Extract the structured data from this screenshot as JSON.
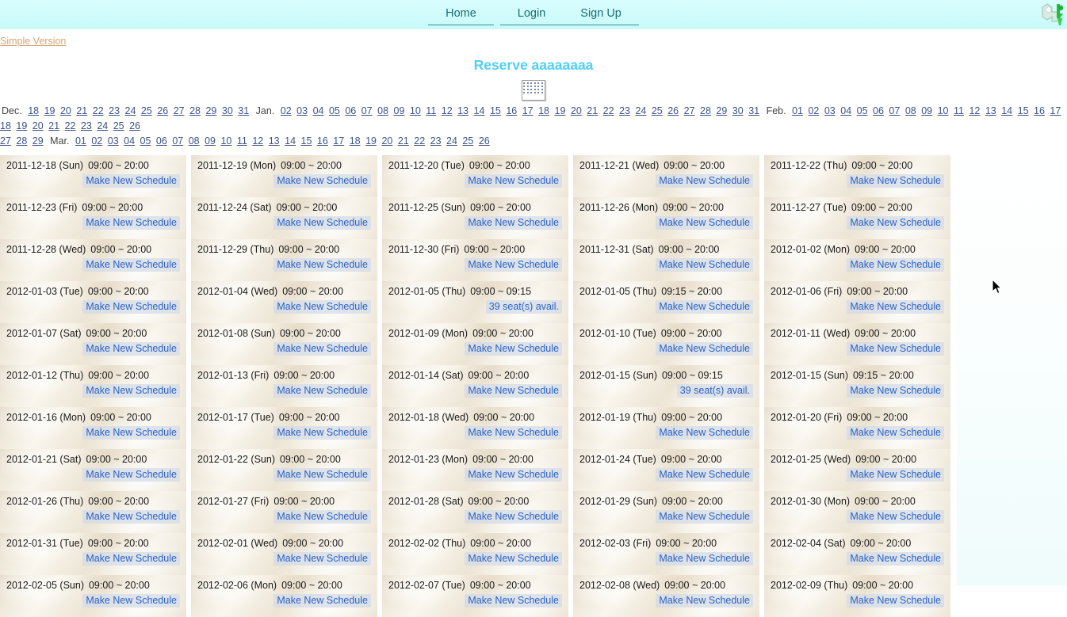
{
  "topbar": {
    "nav": [
      {
        "label": "Home",
        "name": "nav-home"
      },
      {
        "label": "Login",
        "name": "nav-login"
      },
      {
        "label": "Sign Up",
        "name": "nav-signup"
      }
    ],
    "logo_alt": "logo-icon",
    "background_color": "#ccfbfb",
    "link_color": "#1a6e6e"
  },
  "simple_version": {
    "label": "Simple Version",
    "color": "#d8a472"
  },
  "title": {
    "text": "Reserve aaaaaaaa",
    "color": "#4fd0f7"
  },
  "calendar_icon": {
    "name": "calendar-icon"
  },
  "date_nav": {
    "link_color": "#3b5487",
    "lines": [
      [
        {
          "type": "month",
          "text": "Dec."
        },
        {
          "type": "day",
          "text": "18"
        },
        {
          "type": "day",
          "text": "19"
        },
        {
          "type": "day",
          "text": "20"
        },
        {
          "type": "day",
          "text": "21"
        },
        {
          "type": "day",
          "text": "22"
        },
        {
          "type": "day",
          "text": "23"
        },
        {
          "type": "day",
          "text": "24"
        },
        {
          "type": "day",
          "text": "25"
        },
        {
          "type": "day",
          "text": "26"
        },
        {
          "type": "day",
          "text": "27"
        },
        {
          "type": "day",
          "text": "28"
        },
        {
          "type": "day",
          "text": "29"
        },
        {
          "type": "day",
          "text": "30"
        },
        {
          "type": "day",
          "text": "31"
        },
        {
          "type": "month",
          "text": "Jan."
        },
        {
          "type": "day",
          "text": "02"
        },
        {
          "type": "day",
          "text": "03"
        },
        {
          "type": "day",
          "text": "04"
        },
        {
          "type": "day",
          "text": "05"
        },
        {
          "type": "day",
          "text": "06"
        },
        {
          "type": "day",
          "text": "07"
        },
        {
          "type": "day",
          "text": "08"
        },
        {
          "type": "day",
          "text": "09"
        },
        {
          "type": "day",
          "text": "10"
        },
        {
          "type": "day",
          "text": "11"
        },
        {
          "type": "day",
          "text": "12"
        },
        {
          "type": "day",
          "text": "13"
        },
        {
          "type": "day",
          "text": "14"
        },
        {
          "type": "day",
          "text": "15"
        },
        {
          "type": "day",
          "text": "16"
        },
        {
          "type": "day",
          "text": "17"
        },
        {
          "type": "day",
          "text": "18"
        },
        {
          "type": "day",
          "text": "19"
        },
        {
          "type": "day",
          "text": "20"
        },
        {
          "type": "day",
          "text": "21"
        },
        {
          "type": "day",
          "text": "22"
        },
        {
          "type": "day",
          "text": "23"
        },
        {
          "type": "day",
          "text": "24"
        },
        {
          "type": "day",
          "text": "25"
        },
        {
          "type": "day",
          "text": "26"
        },
        {
          "type": "day",
          "text": "27"
        },
        {
          "type": "day",
          "text": "28"
        },
        {
          "type": "day",
          "text": "29"
        },
        {
          "type": "day",
          "text": "30"
        },
        {
          "type": "day",
          "text": "31"
        },
        {
          "type": "month",
          "text": "Feb."
        },
        {
          "type": "day",
          "text": "01"
        },
        {
          "type": "day",
          "text": "02"
        },
        {
          "type": "day",
          "text": "03"
        },
        {
          "type": "day",
          "text": "04"
        },
        {
          "type": "day",
          "text": "05"
        },
        {
          "type": "day",
          "text": "06"
        },
        {
          "type": "day",
          "text": "07"
        },
        {
          "type": "day",
          "text": "08"
        },
        {
          "type": "day",
          "text": "09"
        },
        {
          "type": "day",
          "text": "10"
        },
        {
          "type": "day",
          "text": "11"
        },
        {
          "type": "day",
          "text": "12"
        },
        {
          "type": "day",
          "text": "13"
        },
        {
          "type": "day",
          "text": "14"
        },
        {
          "type": "day",
          "text": "15"
        },
        {
          "type": "day",
          "text": "16"
        },
        {
          "type": "day",
          "text": "17"
        },
        {
          "type": "day",
          "text": "18"
        },
        {
          "type": "day",
          "text": "19"
        },
        {
          "type": "day",
          "text": "20"
        },
        {
          "type": "day",
          "text": "21"
        },
        {
          "type": "day",
          "text": "22"
        },
        {
          "type": "day",
          "text": "23"
        },
        {
          "type": "day",
          "text": "24"
        },
        {
          "type": "day",
          "text": "25"
        },
        {
          "type": "day",
          "text": "26"
        }
      ],
      [
        {
          "type": "day",
          "text": "27"
        },
        {
          "type": "day",
          "text": "28"
        },
        {
          "type": "day",
          "text": "29"
        },
        {
          "type": "month",
          "text": "Mar."
        },
        {
          "type": "day",
          "text": "01"
        },
        {
          "type": "day",
          "text": "02"
        },
        {
          "type": "day",
          "text": "03"
        },
        {
          "type": "day",
          "text": "04"
        },
        {
          "type": "day",
          "text": "05"
        },
        {
          "type": "day",
          "text": "06"
        },
        {
          "type": "day",
          "text": "07"
        },
        {
          "type": "day",
          "text": "08"
        },
        {
          "type": "day",
          "text": "09"
        },
        {
          "type": "day",
          "text": "10"
        },
        {
          "type": "day",
          "text": "11"
        },
        {
          "type": "day",
          "text": "12"
        },
        {
          "type": "day",
          "text": "13"
        },
        {
          "type": "day",
          "text": "14"
        },
        {
          "type": "day",
          "text": "15"
        },
        {
          "type": "day",
          "text": "16"
        },
        {
          "type": "day",
          "text": "17"
        },
        {
          "type": "day",
          "text": "18"
        },
        {
          "type": "day",
          "text": "19"
        },
        {
          "type": "day",
          "text": "20"
        },
        {
          "type": "day",
          "text": "21"
        },
        {
          "type": "day",
          "text": "22"
        },
        {
          "type": "day",
          "text": "23"
        },
        {
          "type": "day",
          "text": "24"
        },
        {
          "type": "day",
          "text": "25"
        },
        {
          "type": "day",
          "text": "26"
        }
      ]
    ]
  },
  "schedule": {
    "action_label": "Make New Schedule",
    "action_color": "#2a62c8",
    "rows": [
      [
        {
          "date": "2011-12-18 (Sun)",
          "time": "09:00 ~ 20:00",
          "action": "Make New Schedule"
        },
        {
          "date": "2011-12-19 (Mon)",
          "time": "09:00 ~ 20:00",
          "action": "Make New Schedule"
        },
        {
          "date": "2011-12-20 (Tue)",
          "time": "09:00 ~ 20:00",
          "action": "Make New Schedule"
        },
        {
          "date": "2011-12-21 (Wed)",
          "time": "09:00 ~ 20:00",
          "action": "Make New Schedule"
        },
        {
          "date": "2011-12-22 (Thu)",
          "time": "09:00 ~ 20:00",
          "action": "Make New Schedule"
        }
      ],
      [
        {
          "date": "2011-12-23 (Fri)",
          "time": "09:00 ~ 20:00",
          "action": "Make New Schedule"
        },
        {
          "date": "2011-12-24 (Sat)",
          "time": "09:00 ~ 20:00",
          "action": "Make New Schedule"
        },
        {
          "date": "2011-12-25 (Sun)",
          "time": "09:00 ~ 20:00",
          "action": "Make New Schedule"
        },
        {
          "date": "2011-12-26 (Mon)",
          "time": "09:00 ~ 20:00",
          "action": "Make New Schedule"
        },
        {
          "date": "2011-12-27 (Tue)",
          "time": "09:00 ~ 20:00",
          "action": "Make New Schedule"
        }
      ],
      [
        {
          "date": "2011-12-28 (Wed)",
          "time": "09:00 ~ 20:00",
          "action": "Make New Schedule"
        },
        {
          "date": "2011-12-29 (Thu)",
          "time": "09:00 ~ 20:00",
          "action": "Make New Schedule"
        },
        {
          "date": "2011-12-30 (Fri)",
          "time": "09:00 ~ 20:00",
          "action": "Make New Schedule"
        },
        {
          "date": "2011-12-31 (Sat)",
          "time": "09:00 ~ 20:00",
          "action": "Make New Schedule"
        },
        {
          "date": "2012-01-02 (Mon)",
          "time": "09:00 ~ 20:00",
          "action": "Make New Schedule"
        }
      ],
      [
        {
          "date": "2012-01-03 (Tue)",
          "time": "09:00 ~ 20:00",
          "action": "Make New Schedule"
        },
        {
          "date": "2012-01-04 (Wed)",
          "time": "09:00 ~ 20:00",
          "action": "Make New Schedule"
        },
        {
          "date": "2012-01-05 (Thu)",
          "time": "09:00 ~ 09:15",
          "action": "39 seat(s) avail."
        },
        {
          "date": "2012-01-05 (Thu)",
          "time": "09:15 ~ 20:00",
          "action": "Make New Schedule"
        },
        {
          "date": "2012-01-06 (Fri)",
          "time": "09:00 ~ 20:00",
          "action": "Make New Schedule"
        }
      ],
      [
        {
          "date": "2012-01-07 (Sat)",
          "time": "09:00 ~ 20:00",
          "action": "Make New Schedule"
        },
        {
          "date": "2012-01-08 (Sun)",
          "time": "09:00 ~ 20:00",
          "action": "Make New Schedule"
        },
        {
          "date": "2012-01-09 (Mon)",
          "time": "09:00 ~ 20:00",
          "action": "Make New Schedule"
        },
        {
          "date": "2012-01-10 (Tue)",
          "time": "09:00 ~ 20:00",
          "action": "Make New Schedule"
        },
        {
          "date": "2012-01-11 (Wed)",
          "time": "09:00 ~ 20:00",
          "action": "Make New Schedule"
        }
      ],
      [
        {
          "date": "2012-01-12 (Thu)",
          "time": "09:00 ~ 20:00",
          "action": "Make New Schedule"
        },
        {
          "date": "2012-01-13 (Fri)",
          "time": "09:00 ~ 20:00",
          "action": "Make New Schedule"
        },
        {
          "date": "2012-01-14 (Sat)",
          "time": "09:00 ~ 20:00",
          "action": "Make New Schedule"
        },
        {
          "date": "2012-01-15 (Sun)",
          "time": "09:00 ~ 09:15",
          "action": "39 seat(s) avail."
        },
        {
          "date": "2012-01-15 (Sun)",
          "time": "09:15 ~ 20:00",
          "action": "Make New Schedule"
        }
      ],
      [
        {
          "date": "2012-01-16 (Mon)",
          "time": "09:00 ~ 20:00",
          "action": "Make New Schedule"
        },
        {
          "date": "2012-01-17 (Tue)",
          "time": "09:00 ~ 20:00",
          "action": "Make New Schedule"
        },
        {
          "date": "2012-01-18 (Wed)",
          "time": "09:00 ~ 20:00",
          "action": "Make New Schedule"
        },
        {
          "date": "2012-01-19 (Thu)",
          "time": "09:00 ~ 20:00",
          "action": "Make New Schedule"
        },
        {
          "date": "2012-01-20 (Fri)",
          "time": "09:00 ~ 20:00",
          "action": "Make New Schedule"
        }
      ],
      [
        {
          "date": "2012-01-21 (Sat)",
          "time": "09:00 ~ 20:00",
          "action": "Make New Schedule"
        },
        {
          "date": "2012-01-22 (Sun)",
          "time": "09:00 ~ 20:00",
          "action": "Make New Schedule"
        },
        {
          "date": "2012-01-23 (Mon)",
          "time": "09:00 ~ 20:00",
          "action": "Make New Schedule"
        },
        {
          "date": "2012-01-24 (Tue)",
          "time": "09:00 ~ 20:00",
          "action": "Make New Schedule"
        },
        {
          "date": "2012-01-25 (Wed)",
          "time": "09:00 ~ 20:00",
          "action": "Make New Schedule"
        }
      ],
      [
        {
          "date": "2012-01-26 (Thu)",
          "time": "09:00 ~ 20:00",
          "action": "Make New Schedule"
        },
        {
          "date": "2012-01-27 (Fri)",
          "time": "09:00 ~ 20:00",
          "action": "Make New Schedule"
        },
        {
          "date": "2012-01-28 (Sat)",
          "time": "09:00 ~ 20:00",
          "action": "Make New Schedule"
        },
        {
          "date": "2012-01-29 (Sun)",
          "time": "09:00 ~ 20:00",
          "action": "Make New Schedule"
        },
        {
          "date": "2012-01-30 (Mon)",
          "time": "09:00 ~ 20:00",
          "action": "Make New Schedule"
        }
      ],
      [
        {
          "date": "2012-01-31 (Tue)",
          "time": "09:00 ~ 20:00",
          "action": "Make New Schedule"
        },
        {
          "date": "2012-02-01 (Wed)",
          "time": "09:00 ~ 20:00",
          "action": "Make New Schedule"
        },
        {
          "date": "2012-02-02 (Thu)",
          "time": "09:00 ~ 20:00",
          "action": "Make New Schedule"
        },
        {
          "date": "2012-02-03 (Fri)",
          "time": "09:00 ~ 20:00",
          "action": "Make New Schedule"
        },
        {
          "date": "2012-02-04 (Sat)",
          "time": "09:00 ~ 20:00",
          "action": "Make New Schedule"
        }
      ],
      [
        {
          "date": "2012-02-05 (Sun)",
          "time": "09:00 ~ 20:00",
          "action": "Make New Schedule"
        },
        {
          "date": "2012-02-06 (Mon)",
          "time": "09:00 ~ 20:00",
          "action": "Make New Schedule"
        },
        {
          "date": "2012-02-07 (Tue)",
          "time": "09:00 ~ 20:00",
          "action": "Make New Schedule"
        },
        {
          "date": "2012-02-08 (Wed)",
          "time": "09:00 ~ 20:00",
          "action": "Make New Schedule"
        },
        {
          "date": "2012-02-09 (Thu)",
          "time": "09:00 ~ 20:00",
          "action": "Make New Schedule"
        }
      ]
    ]
  }
}
